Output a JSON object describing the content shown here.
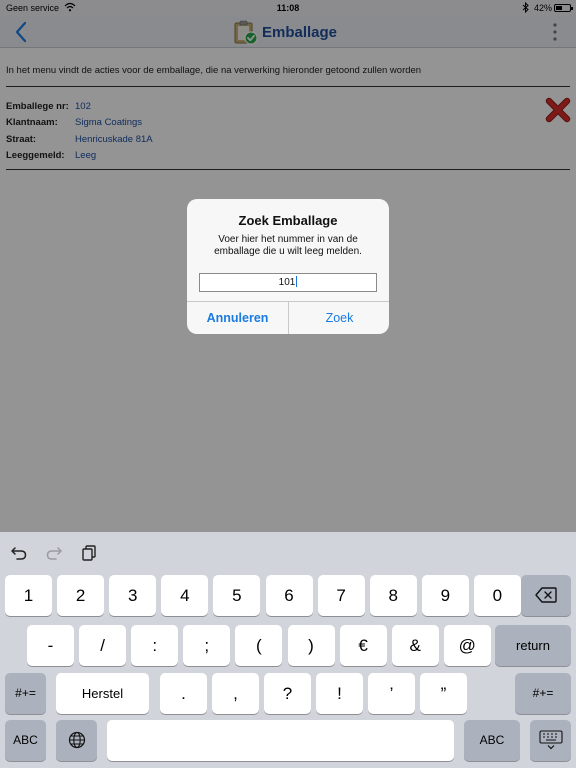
{
  "status_bar": {
    "carrier": "Geen service",
    "time": "11:08",
    "battery": "42%",
    "battery_level": 0.42
  },
  "nav": {
    "title": "Emballage"
  },
  "intro_text": "In het menu vindt de acties voor de emballage, die na verwerking hieronder getoond zullen worden",
  "details": [
    {
      "label": "Emballege nr:",
      "value": "102"
    },
    {
      "label": "Klantnaam:",
      "value": "Sigma Coatings"
    },
    {
      "label": "Straat:",
      "value": "Henricuskade 81A"
    },
    {
      "label": "Leeggemeld:",
      "value": "Leeg"
    }
  ],
  "colors": {
    "accent": "#1a7ce0",
    "title_blue": "#1f4f9a",
    "value_blue": "#1e4fa0",
    "close_red": "#d9302c"
  },
  "dialog": {
    "title": "Zoek Emballage",
    "message": "Voer hier het nummer in van de emballage die u wilt leeg melden.",
    "input_value": "101",
    "cancel_label": "Annuleren",
    "ok_label": "Zoek"
  },
  "keyboard": {
    "row1": [
      "1",
      "2",
      "3",
      "4",
      "5",
      "6",
      "7",
      "8",
      "9",
      "0"
    ],
    "row2": [
      "-",
      "/",
      ":",
      ";",
      "(",
      ")",
      "€",
      "&",
      "@"
    ],
    "return_label": "return",
    "row3_left": "#+=",
    "herstel_label": "Herstel",
    "row3": [
      ".",
      ",",
      "?",
      "!",
      "’",
      "”"
    ],
    "row3_right": "#+=",
    "abc_left": "ABC",
    "abc_right": "ABC",
    "icons": [
      "undo-icon",
      "redo-icon",
      "paste-icon",
      "backspace-icon",
      "globe-icon",
      "keyboard-dismiss-icon"
    ]
  }
}
